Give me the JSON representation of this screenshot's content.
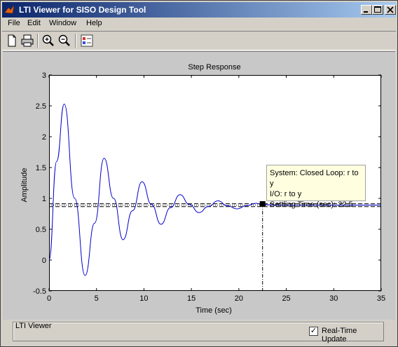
{
  "window": {
    "title": "LTI Viewer for SISO Design Tool",
    "controls": [
      "minimize",
      "maximize",
      "close"
    ]
  },
  "menu": {
    "items": [
      {
        "label": "File"
      },
      {
        "label": "Edit"
      },
      {
        "label": "Window"
      },
      {
        "label": "Help"
      }
    ]
  },
  "toolbar": {
    "icons": [
      "new-document-icon",
      "print-icon",
      "zoom-in-icon",
      "zoom-out-icon",
      "plot-config-icon"
    ]
  },
  "chart_data": {
    "type": "line",
    "title": "Step Response",
    "xlabel": "Time (sec)",
    "ylabel": "Amplitude",
    "xlim": [
      0,
      35
    ],
    "ylim": [
      -0.5,
      3
    ],
    "xticks": [
      "0",
      "5",
      "10",
      "15",
      "20",
      "25",
      "30",
      "35"
    ],
    "yticks": [
      "-0.5",
      "0",
      "0.5",
      "1",
      "1.5",
      "2",
      "2.5",
      "3"
    ],
    "grid": false,
    "series": [
      {
        "color": "#0000cc",
        "x": [
          0,
          0.8,
          1.6,
          2.7,
          3.8,
          4.8,
          5.8,
          6.8,
          7.8,
          8.8,
          9.8,
          10.8,
          11.8,
          12.8,
          13.8,
          14.8,
          15.8,
          16.8,
          17.8,
          18.8,
          19.8,
          20.8,
          21.8,
          22.5,
          24,
          26,
          28,
          30,
          35
        ],
        "y": [
          0,
          1.6,
          2.53,
          1.0,
          -0.25,
          0.6,
          1.65,
          1.0,
          0.33,
          0.8,
          1.27,
          0.9,
          0.58,
          0.85,
          1.06,
          0.9,
          0.77,
          0.87,
          0.96,
          0.88,
          0.83,
          0.88,
          0.92,
          0.9,
          0.89,
          0.89,
          0.89,
          0.89,
          0.89
        ]
      }
    ],
    "reference_lines": [
      0.89,
      0.867,
      0.913
    ],
    "settling_marker": {
      "x": 22.5,
      "y": 0.91
    },
    "tooltip": {
      "system": "System: Closed Loop: r to y",
      "io": "I/O: r to y",
      "settling": "Settling Time (sec): 22.5"
    }
  },
  "status": {
    "panel_label": "LTI Viewer",
    "realtime_label": "Real-Time Update",
    "realtime_checked": true,
    "check_glyph": "✓"
  }
}
